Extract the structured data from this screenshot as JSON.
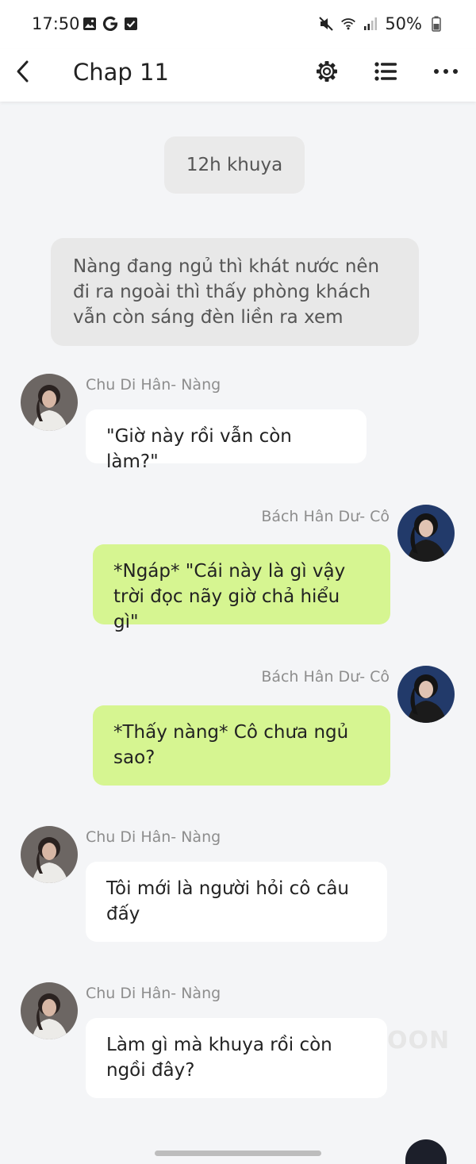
{
  "status_bar": {
    "time": "17:50",
    "battery": "50%",
    "left_icons": [
      "gallery-icon",
      "google-icon",
      "checkbox-icon"
    ],
    "right_icons": [
      "mute-icon",
      "wifi-icon",
      "signal-icon",
      "battery-icon"
    ]
  },
  "header": {
    "title": "Chap 11",
    "icons": [
      "back-icon",
      "settings-icon",
      "list-icon",
      "more-icon"
    ]
  },
  "chat": {
    "time_label": "12h khuya",
    "narration": "Nàng đang ngủ thì khát nước nên đi ra ngoài thì thấy phòng khách vẫn còn sáng đèn liền ra xem",
    "messages": [
      {
        "side": "left",
        "name": "Chu Di Hân- Nàng",
        "text": "\"Giờ này rồi vẫn còn làm?\""
      },
      {
        "side": "right",
        "name": "Bách Hân Dư- Cô",
        "text": "*Ngáp*  \"Cái này là gì vậy trời đọc nãy giờ chả hiểu gì\""
      },
      {
        "side": "right",
        "name": "Bách Hân Dư- Cô",
        "text": "*Thấy nàng* Cô chưa ngủ sao?"
      },
      {
        "side": "left",
        "name": "Chu Di Hân- Nàng",
        "text": "Tôi mới là người hỏi cô câu đấy"
      },
      {
        "side": "left",
        "name": "Chu Di Hân- Nàng",
        "text": "Làm gì mà khuya rồi còn ngồi đây?"
      }
    ]
  },
  "watermark": "OON",
  "colors": {
    "right_bubble": "#d6f591",
    "left_bubble": "#ffffff",
    "background": "#f4f5f7"
  }
}
